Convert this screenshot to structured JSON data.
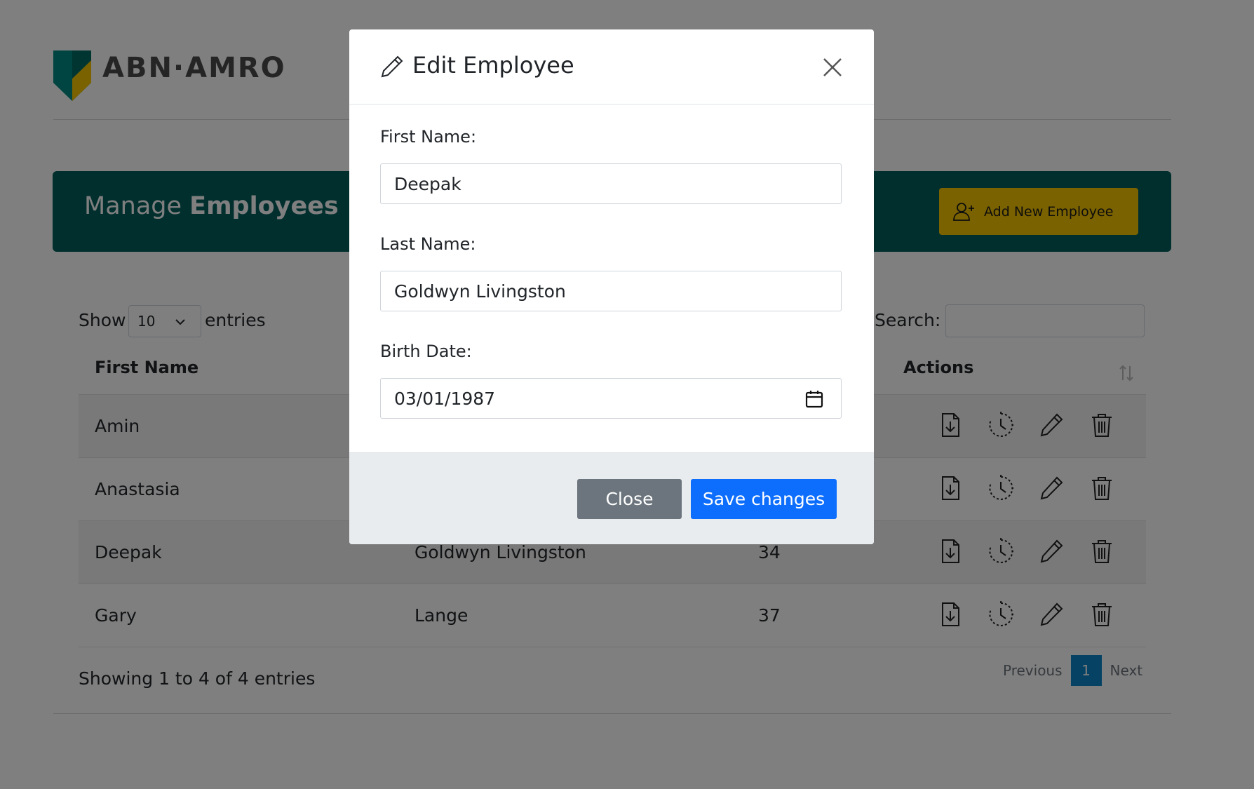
{
  "brand": {
    "name": "ABN·AMRO",
    "colors": {
      "green": "#005e5d",
      "yellow": "#f4c400"
    }
  },
  "banner": {
    "title_light": "Manage ",
    "title_bold": "Employees",
    "add_button_label": "Add New Employee",
    "add_button_icon": "person-plus-icon"
  },
  "table_controls": {
    "show_label": "Show",
    "page_length": "10",
    "entries_label": "entries",
    "search_label": "Search:",
    "search_value": ""
  },
  "table": {
    "headers": {
      "first_name": "First Name",
      "actions": "Actions"
    },
    "rows": [
      {
        "first_name": "Amin",
        "last_name": "",
        "age": ""
      },
      {
        "first_name": "Anastasia",
        "last_name": "",
        "age": ""
      },
      {
        "first_name": "Deepak",
        "last_name": "Goldwyn Livingston",
        "age": "34"
      },
      {
        "first_name": "Gary",
        "last_name": "Lange",
        "age": "37"
      }
    ],
    "row_action_icons": [
      "download-file-icon",
      "clock-history-icon",
      "pencil-icon",
      "trash-icon"
    ]
  },
  "footer": {
    "info": "Showing 1 to 4 of 4 entries",
    "previous": "Previous",
    "current_page": "1",
    "next": "Next"
  },
  "modal": {
    "title": "Edit Employee",
    "title_icon": "pencil-icon",
    "fields": {
      "first_name_label": "First Name:",
      "first_name_value": "Deepak",
      "last_name_label": "Last Name:",
      "last_name_value": "Goldwyn Livingston",
      "birth_date_label": "Birth Date:",
      "birth_date_value": "03/01/1987"
    },
    "close_button": "Close",
    "save_button": "Save changes",
    "colors": {
      "save": "#0d6efd",
      "close": "#6c757d"
    }
  }
}
